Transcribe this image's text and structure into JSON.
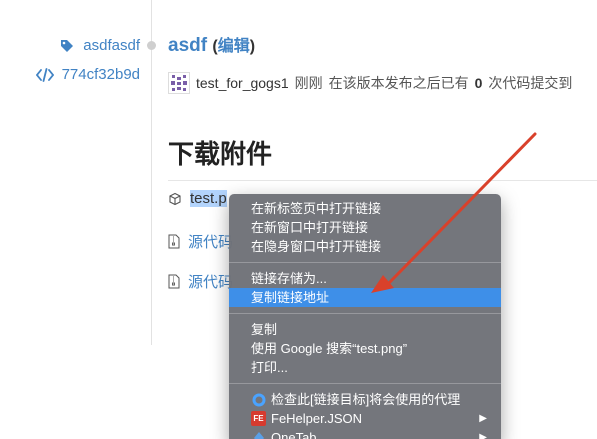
{
  "sidebar": {
    "tag": "asdfasdf",
    "commit": "774cf32b9d"
  },
  "release": {
    "name": "asdf",
    "open_paren": "(",
    "edit": "编辑",
    "close_paren": ")",
    "author": "test_for_gogs1",
    "time": "刚刚",
    "info_prefix": "在该版本发布之后已有",
    "commit_count": "0",
    "info_suffix": "次代码提交到"
  },
  "downloads": {
    "title": "下载附件",
    "items": [
      {
        "label": "test.p",
        "icon": "package-icon"
      },
      {
        "label": "源代码",
        "icon": "file-zip-icon"
      },
      {
        "label": "源代码",
        "icon": "file-zip-icon"
      }
    ]
  },
  "context_menu": {
    "items": [
      "在新标签页中打开链接",
      "在新窗口中打开链接",
      "在隐身窗口中打开链接",
      "链接存储为...",
      "复制链接地址",
      "复制",
      "使用 Google 搜索“test.png”",
      "打印...",
      "检查此[链接目标]将会使用的代理",
      "FeHelper.JSON",
      "OneTab"
    ],
    "fe_badge": "FE",
    "highlight_color": "#3e8fe8"
  },
  "colors": {
    "link": "#4183c4",
    "annotation_arrow": "#d9412b"
  }
}
